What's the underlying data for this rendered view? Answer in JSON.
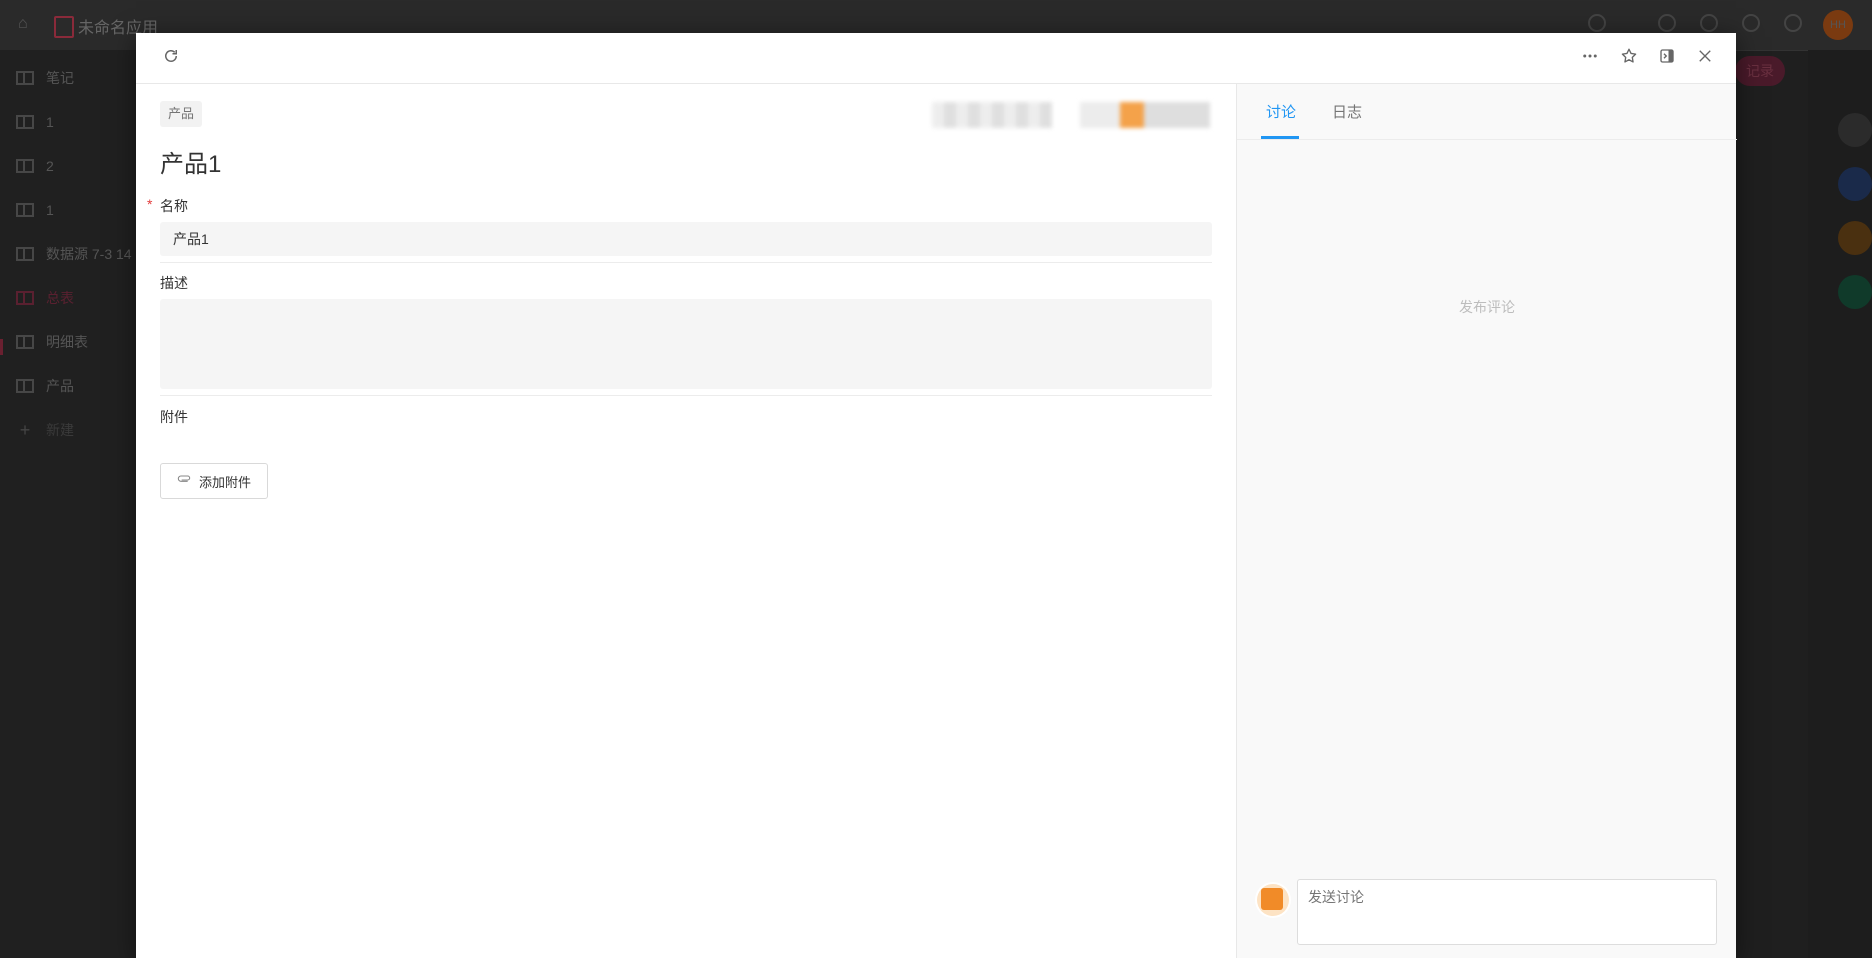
{
  "background": {
    "app_title": "未命名应用",
    "sidebar_items": [
      "笔记",
      "1",
      "2",
      "1",
      "数据源 7-3 14",
      "总表",
      "明细表",
      "产品",
      "新建"
    ],
    "bg_button": "记录",
    "bg_avatar": "HH"
  },
  "modal": {
    "header": {
      "refresh_icon": "refresh-icon",
      "more_icon": "more-icon",
      "star_icon": "star-icon",
      "panel_icon": "panel-toggle-icon",
      "close_icon": "close-icon"
    },
    "worksheet_tag": "产品",
    "record_title": "产品1",
    "fields": {
      "name_label": "名称",
      "name_required_mark": "*",
      "name_value": "产品1",
      "description_label": "描述",
      "description_value": "",
      "attachment_label": "附件",
      "attachment_button": "添加附件"
    },
    "discussion": {
      "tabs": [
        "讨论",
        "日志"
      ],
      "active_tab": "讨论",
      "empty_hint": "发布评论",
      "comment_placeholder": "发送讨论"
    }
  },
  "colors": {
    "accent": "#2196f3",
    "required": "#e23b3b",
    "avatar": "#f18b28"
  }
}
